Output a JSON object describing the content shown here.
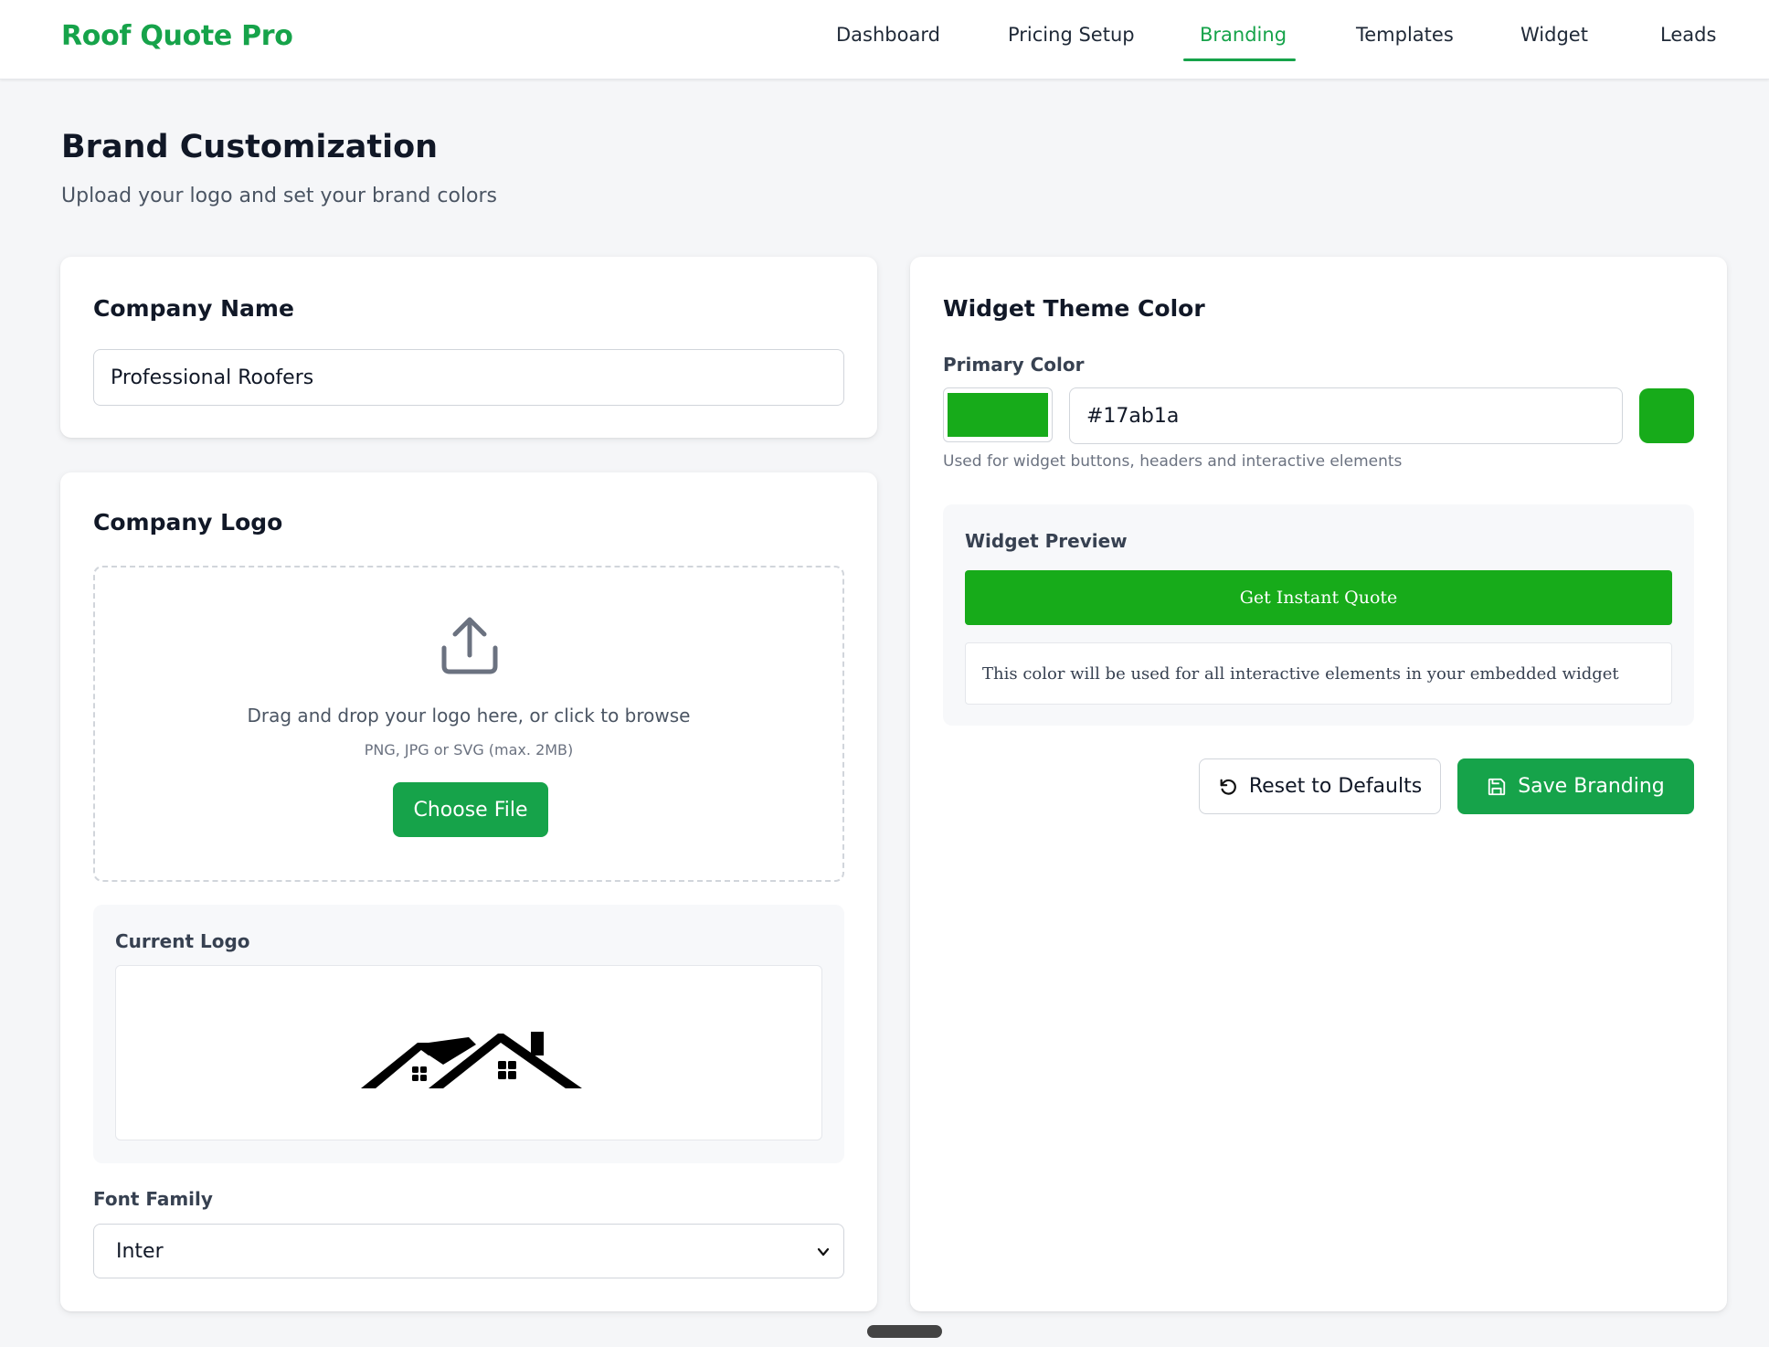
{
  "app": {
    "brand": "Roof Quote Pro",
    "accent_color": "#16a34a"
  },
  "nav": {
    "items": [
      {
        "label": "Dashboard",
        "active": false
      },
      {
        "label": "Pricing Setup",
        "active": false
      },
      {
        "label": "Branding",
        "active": true
      },
      {
        "label": "Templates",
        "active": false
      },
      {
        "label": "Widget",
        "active": false
      },
      {
        "label": "Leads",
        "active": false
      }
    ]
  },
  "page": {
    "title": "Brand Customization",
    "subtitle": "Upload your logo and set your brand colors"
  },
  "company_name": {
    "heading": "Company Name",
    "value": "Professional Roofers"
  },
  "company_logo": {
    "heading": "Company Logo",
    "drop_text": "Drag and drop your logo here, or click to browse",
    "hint": "PNG, JPG or SVG (max. 2MB)",
    "choose_label": "Choose File",
    "upload_icon": "upload-icon",
    "current_label": "Current Logo",
    "current_logo_icon": "house-roof-logo"
  },
  "font_family": {
    "label": "Font Family",
    "selected": "Inter"
  },
  "theme": {
    "heading": "Widget Theme Color",
    "primary_label": "Primary Color",
    "primary_value": "#17ab1a",
    "primary_swatch_color": "#17ab1a",
    "help": "Used for widget buttons, headers and interactive elements"
  },
  "preview": {
    "label": "Widget Preview",
    "button_label": "Get Instant Quote",
    "note": "This color will be used for all interactive elements in your embedded widget"
  },
  "actions": {
    "reset_label": "Reset to Defaults",
    "reset_icon": "rotate-ccw-icon",
    "save_label": "Save Branding",
    "save_icon": "floppy-disk-icon"
  }
}
